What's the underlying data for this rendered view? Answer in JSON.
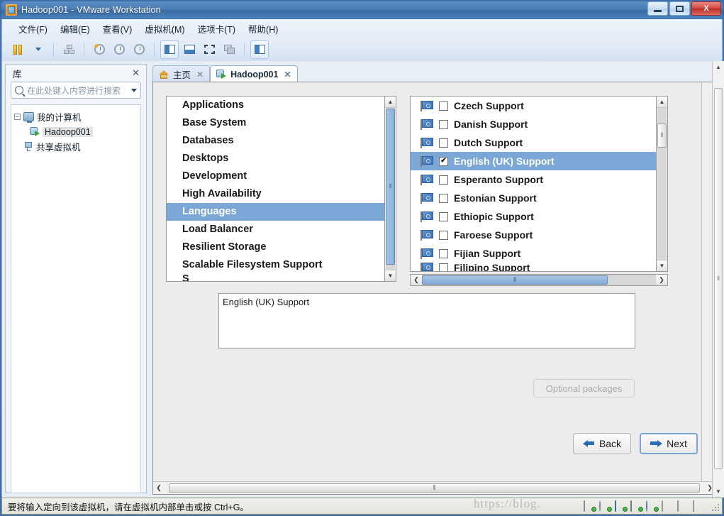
{
  "window": {
    "title": "Hadoop001 - VMware Workstation",
    "app_icon": "vmware-logo-icon",
    "minimize_label": "Minimize",
    "maximize_label": "Maximize",
    "close_label": "X"
  },
  "menubar": {
    "items": [
      {
        "label": "文件(F)",
        "name": "menu-file"
      },
      {
        "label": "编辑(E)",
        "name": "menu-edit"
      },
      {
        "label": "查看(V)",
        "name": "menu-view"
      },
      {
        "label": "虚拟机(M)",
        "name": "menu-vm"
      },
      {
        "label": "选项卡(T)",
        "name": "menu-tabs"
      },
      {
        "label": "帮助(H)",
        "name": "menu-help"
      }
    ]
  },
  "toolbar": {
    "buttons": [
      {
        "name": "power-icon",
        "title": "电源"
      },
      {
        "name": "chevron-down-icon",
        "title": "下拉"
      },
      {
        "name": "snapshot-manager-icon",
        "title": "快照管理器"
      },
      {
        "name": "take-snapshot-icon",
        "title": "拍摄快照"
      },
      {
        "name": "revert-snapshot-icon",
        "title": "恢复快照"
      },
      {
        "name": "manage-snapshot-icon",
        "title": "管理快照"
      },
      {
        "name": "show-library-icon",
        "title": "显示库"
      },
      {
        "name": "show-thumbnail-bar-icon",
        "title": "显示缩略图栏"
      },
      {
        "name": "full-screen-icon",
        "title": "全屏"
      },
      {
        "name": "unity-mode-icon",
        "title": "Unity 模式"
      },
      {
        "name": "console-view-icon",
        "title": "控制台视图"
      }
    ]
  },
  "library": {
    "title": "库",
    "close_label": "✕",
    "search": {
      "placeholder": "在此处键入内容进行搜索",
      "value": "",
      "icon": "search-icon",
      "caret": "▼"
    },
    "tree": [
      {
        "label": "我的计算机",
        "icon": "my-computer-icon",
        "expander": "−",
        "level": 0,
        "selected": false
      },
      {
        "label": "Hadoop001",
        "icon": "virtual-machine-icon",
        "expander": "",
        "level": 1,
        "selected": true
      },
      {
        "label": "共享虚拟机",
        "icon": "shared-vms-icon",
        "expander": "",
        "level": 0,
        "selected": false
      }
    ]
  },
  "tabs": [
    {
      "label": "主页",
      "icon": "home-icon",
      "close": "✕",
      "active": false
    },
    {
      "label": "Hadoop001",
      "icon": "virtual-machine-icon",
      "close": "✕",
      "active": true
    }
  ],
  "installer": {
    "categories": [
      {
        "label": "Applications",
        "selected": false
      },
      {
        "label": "Base System",
        "selected": false
      },
      {
        "label": "Databases",
        "selected": false
      },
      {
        "label": "Desktops",
        "selected": false
      },
      {
        "label": "Development",
        "selected": false
      },
      {
        "label": "High Availability",
        "selected": false
      },
      {
        "label": "Languages",
        "selected": true
      },
      {
        "label": "Load Balancer",
        "selected": false
      },
      {
        "label": "Resilient Storage",
        "selected": false
      },
      {
        "label": "Scalable Filesystem Support",
        "selected": false
      },
      {
        "label": "S",
        "selected": false
      }
    ],
    "packages": [
      {
        "label": "Czech Support",
        "checked": false,
        "selected": false
      },
      {
        "label": "Danish Support",
        "checked": false,
        "selected": false
      },
      {
        "label": "Dutch Support",
        "checked": false,
        "selected": false
      },
      {
        "label": "English (UK) Support",
        "checked": true,
        "selected": true
      },
      {
        "label": "Esperanto Support",
        "checked": false,
        "selected": false
      },
      {
        "label": "Estonian Support",
        "checked": false,
        "selected": false
      },
      {
        "label": "Ethiopic Support",
        "checked": false,
        "selected": false
      },
      {
        "label": "Faroese Support",
        "checked": false,
        "selected": false
      },
      {
        "label": "Fijian Support",
        "checked": false,
        "selected": false
      },
      {
        "label": "Filipino Support",
        "checked": false,
        "selected": false
      }
    ],
    "description": "English (UK) Support",
    "optional_packages_label": "Optional packages",
    "back_label": "Back",
    "next_label": "Next",
    "checkbox_check": "✔",
    "scroll": {
      "up_arrow": "▲",
      "down_arrow": "▼",
      "left_arrow": "❮",
      "right_arrow": "❯",
      "grip": "⦀"
    },
    "colors": {
      "selection": "#7ba7d7",
      "panel_bg": "#ececec",
      "list_bg": "#ffffff"
    }
  },
  "statusbar": {
    "message": "要将输入定向到该虚拟机，请在虚拟机内部单击或按 Ctrl+G。",
    "devices": [
      {
        "name": "hard-disk-icon"
      },
      {
        "name": "cd-dvd-icon"
      },
      {
        "name": "network-adapter-icon"
      },
      {
        "name": "printer-icon"
      },
      {
        "name": "usb-icon"
      },
      {
        "name": "keyboard-icon"
      },
      {
        "name": "camera-icon"
      },
      {
        "name": "document-icon"
      }
    ]
  },
  "watermark": {
    "text": "https://blog."
  }
}
